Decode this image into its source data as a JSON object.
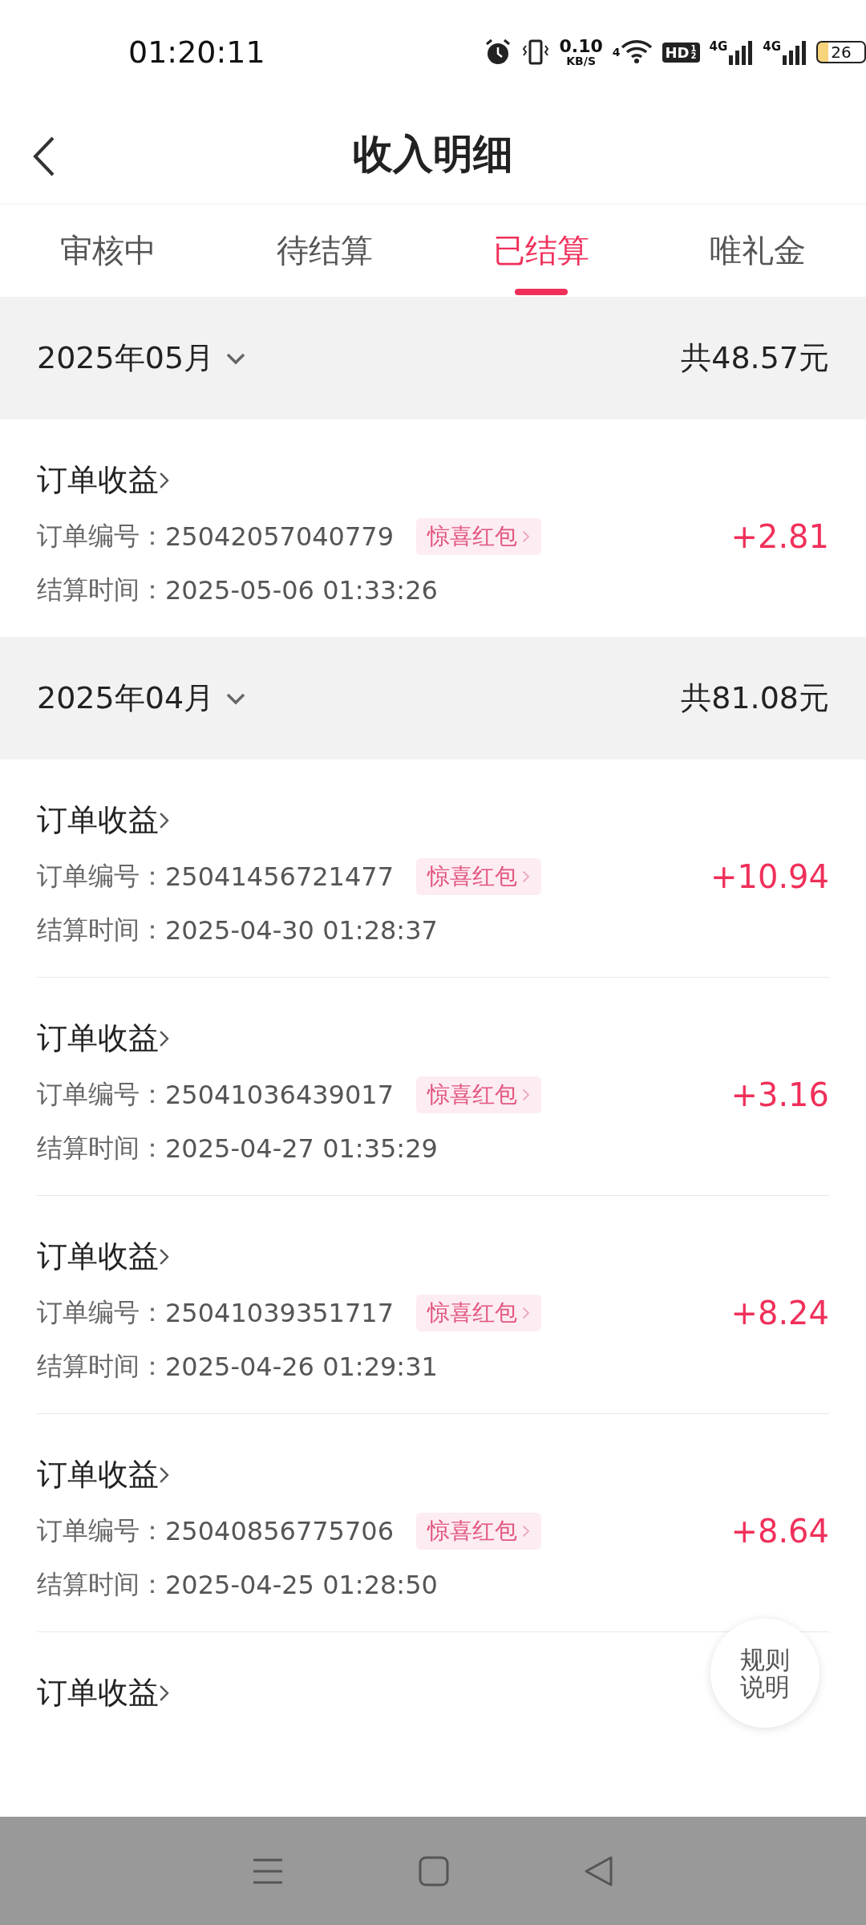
{
  "status_bar": {
    "time": "01:20:11",
    "net_speed": "0.10",
    "net_unit": "KB/S",
    "wifi_label": "4",
    "hd": "HD",
    "hd_slots": [
      "1",
      "2"
    ],
    "signals": [
      {
        "label": "4G"
      },
      {
        "label": "4G"
      }
    ],
    "battery": "26"
  },
  "header": {
    "title": "收入明细"
  },
  "tabs": [
    {
      "label": "审核中",
      "selected": false
    },
    {
      "label": "待结算",
      "selected": false
    },
    {
      "label": "已结算",
      "selected": true
    },
    {
      "label": "唯礼金",
      "selected": false
    }
  ],
  "sections": [
    {
      "month": "2025年05月",
      "total": "共48.57元",
      "entries": [
        {
          "title": "订单收益",
          "order_label": "订单编号：",
          "order_no": "25042057040779",
          "tag": "惊喜红包",
          "amount": "+2.81",
          "time_label": "结算时间：",
          "time": "2025-05-06 01:33:26"
        }
      ]
    },
    {
      "month": "2025年04月",
      "total": "共81.08元",
      "entries": [
        {
          "title": "订单收益",
          "order_label": "订单编号：",
          "order_no": "25041456721477",
          "tag": "惊喜红包",
          "amount": "+10.94",
          "time_label": "结算时间：",
          "time": "2025-04-30 01:28:37"
        },
        {
          "title": "订单收益",
          "order_label": "订单编号：",
          "order_no": "25041036439017",
          "tag": "惊喜红包",
          "amount": "+3.16",
          "time_label": "结算时间：",
          "time": "2025-04-27 01:35:29"
        },
        {
          "title": "订单收益",
          "order_label": "订单编号：",
          "order_no": "25041039351717",
          "tag": "惊喜红包",
          "amount": "+8.24",
          "time_label": "结算时间：",
          "time": "2025-04-26 01:29:31"
        },
        {
          "title": "订单收益",
          "order_label": "订单编号：",
          "order_no": "25040856775706",
          "tag": "惊喜红包",
          "amount": "+8.64",
          "time_label": "结算时间：",
          "time": "2025-04-25 01:28:50"
        },
        {
          "title": "订单收益"
        }
      ]
    }
  ],
  "float_button": {
    "label": "规则说明"
  }
}
